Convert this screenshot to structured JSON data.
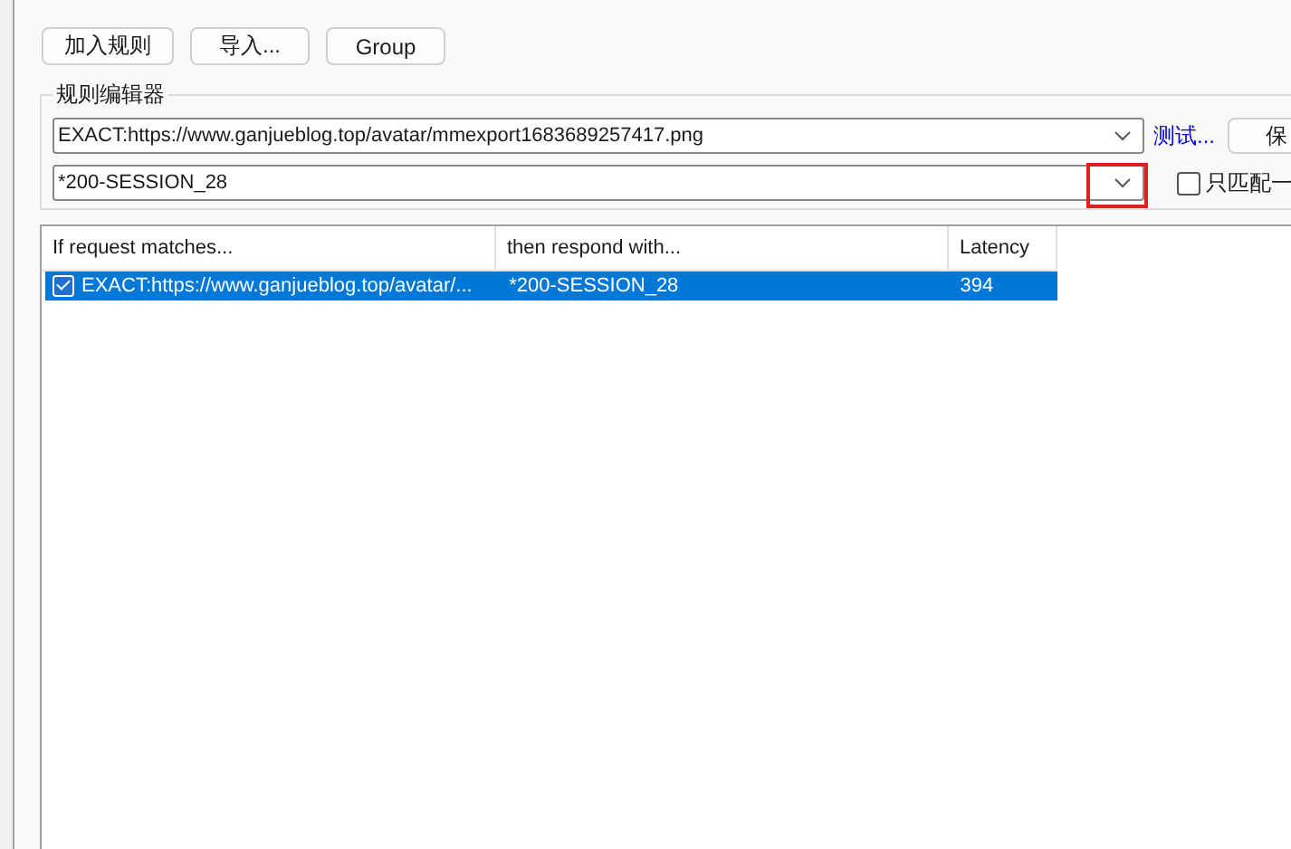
{
  "toolbar": {
    "buttons": [
      "加入规则",
      "导入...",
      "Group"
    ]
  },
  "rule_editor": {
    "title": "规则编辑器",
    "match_field": {
      "value": "EXACT:https://www.ganjueblog.top/avatar/mmexport1683689257417.png"
    },
    "test_link": "测试...",
    "save_button": "保",
    "response_field": {
      "value": "*200-SESSION_28",
      "highlighted": true
    },
    "match_once": {
      "label": "只匹配一",
      "checked": false
    }
  },
  "table": {
    "columns": [
      "If request matches...",
      "then respond with...",
      "Latency"
    ],
    "rows": [
      {
        "enabled": true,
        "selected": true,
        "cells": [
          "EXACT:https://www.ganjueblog.top/avatar/...",
          "*200-SESSION_28",
          "394"
        ]
      }
    ]
  }
}
